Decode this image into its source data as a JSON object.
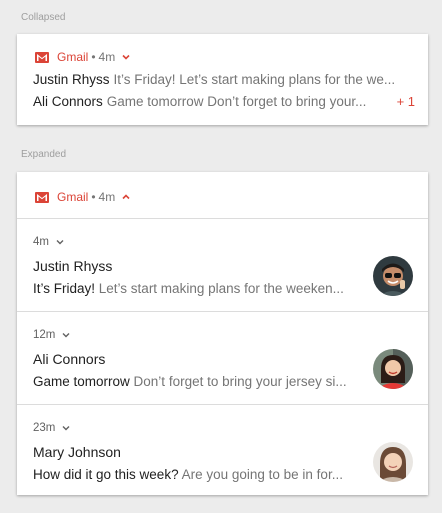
{
  "collapsed_label": "Collapsed",
  "expanded_label": "Expanded",
  "collapsed": {
    "app": "Gmail",
    "time": "4m",
    "rows": [
      {
        "sender": "Justin Rhyss",
        "preview": "It’s Friday! Let’s start making plans for the we..."
      },
      {
        "sender": "Ali Connors",
        "preview": "Game tomorrow Don’t forget to bring your..."
      }
    ],
    "more": "+ 1"
  },
  "expanded": {
    "app": "Gmail",
    "time": "4m",
    "messages": [
      {
        "time": "4m",
        "sender": "Justin Rhyss",
        "subject": "It’s Friday!",
        "preview": "Let’s start making plans for the weeken...",
        "avatar": "avatar-justin"
      },
      {
        "time": "12m",
        "sender": "Ali Connors",
        "subject": "Game tomorrow",
        "preview": "Don’t forget to bring your jersey si...",
        "avatar": "avatar-ali"
      },
      {
        "time": "23m",
        "sender": "Mary Johnson",
        "subject": "How did it go this week?",
        "preview": "Are you going to be in for...",
        "avatar": "avatar-mary"
      }
    ]
  },
  "icons": {
    "app_icon": "gmail-icon",
    "expand": "chevron-down-icon",
    "collapse": "chevron-up-icon"
  },
  "colors": {
    "accent": "#db4437",
    "background": "#ececec",
    "card": "#ffffff"
  }
}
